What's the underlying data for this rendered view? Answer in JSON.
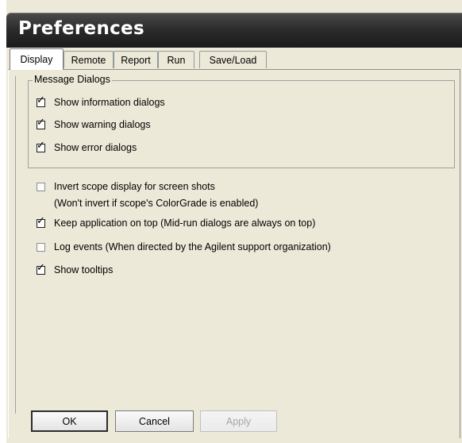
{
  "window": {
    "title": "Preferences"
  },
  "tabs": [
    {
      "label": "Display",
      "active": true
    },
    {
      "label": "Remote",
      "active": false
    },
    {
      "label": "Report",
      "active": false
    },
    {
      "label": "Run",
      "active": false
    },
    {
      "label": "Save/Load",
      "active": false
    }
  ],
  "message_dialogs": {
    "label": "Message Dialogs",
    "options": [
      {
        "label": "Show information dialogs",
        "checked": true
      },
      {
        "label": "Show warning dialogs",
        "checked": true
      },
      {
        "label": "Show error dialogs",
        "checked": true
      }
    ]
  },
  "options": [
    {
      "label": "Invert scope display for screen shots",
      "checked": false,
      "note": "(Won't invert if scope's ColorGrade is enabled)"
    },
    {
      "label": "Keep application on top (Mid-run dialogs are always on top)",
      "checked": true
    },
    {
      "label": "Log events (When directed by the Agilent support organization)",
      "checked": false
    },
    {
      "label": "Show tooltips",
      "checked": true
    }
  ],
  "buttons": {
    "ok": "OK",
    "cancel": "Cancel",
    "apply": "Apply"
  }
}
